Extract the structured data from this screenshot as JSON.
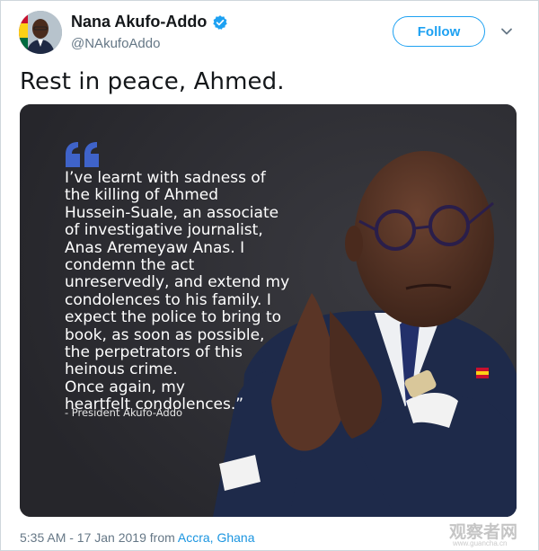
{
  "author": {
    "name": "Nana Akufo-Addo",
    "handle": "@NAkufoAddo",
    "verified_icon": "verified-badge-icon"
  },
  "actions": {
    "follow_label": "Follow",
    "menu_icon": "chevron-down-icon"
  },
  "tweet": {
    "text": "Rest in peace, Ahmed."
  },
  "media": {
    "quote_icon": "quote-mark-icon",
    "quote": "I’ve learnt with sadness of\nthe killing of Ahmed\nHussein-Suale, an associate\nof investigative journalist,\nAnas Aremeyaw Anas. I\ncondemn the act\nunreservedly, and extend my\ncondolences to his family. I\nexpect the police to bring to\nbook, as soon as possible,\nthe perpetrators of this\nheinous crime.\nOnce again, my\nheartfelt condolences.”",
    "attribution": "- President Akufo-Addo",
    "background_color": "#2e2e33",
    "quote_mark_color": "#3f63c9"
  },
  "footer": {
    "timestamp": "5:35 AM - 17 Jan 2019 from ",
    "location": "Accra, Ghana"
  },
  "watermark": {
    "text": "观察者网",
    "sub": "www.guancha.cn"
  },
  "colors": {
    "accent": "#1da1f2",
    "secondary_text": "#657786",
    "link": "#1b95e0"
  }
}
